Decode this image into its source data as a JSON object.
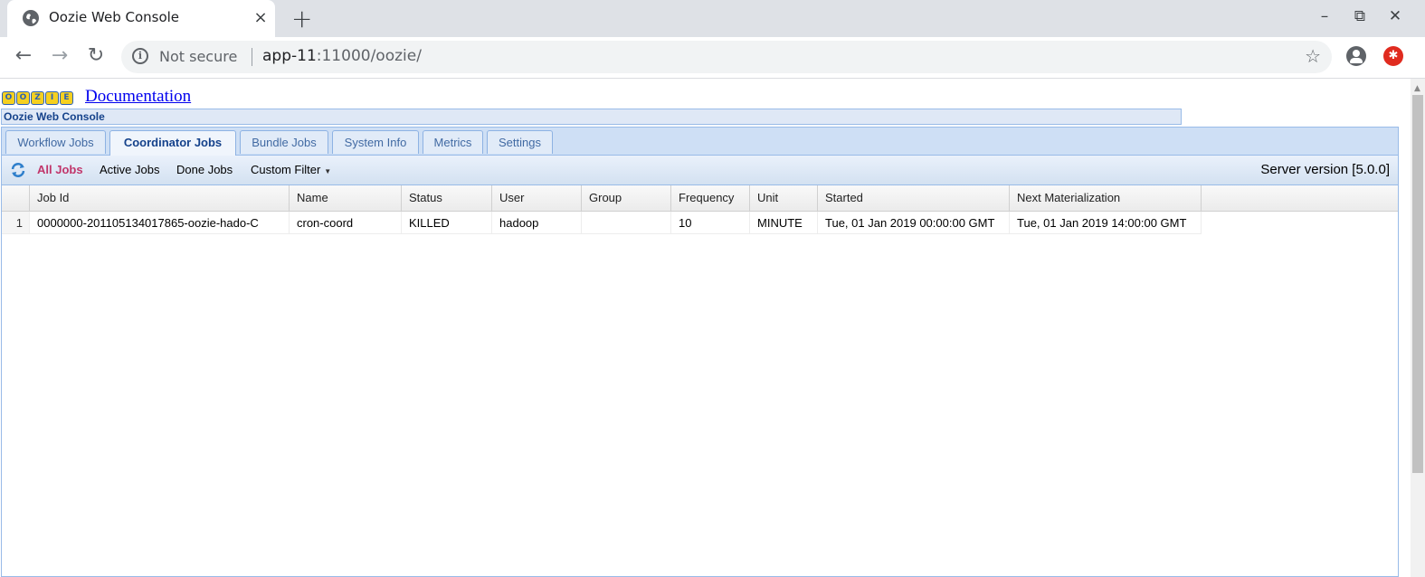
{
  "browser": {
    "tab_title": "Oozie Web Console",
    "tab_close": "×",
    "new_tab": "+",
    "window_controls": {
      "minimize": "–",
      "restore": "⧉",
      "close": "✕"
    },
    "nav": {
      "back": "←",
      "forward": "→",
      "reload": "↻"
    },
    "security_label": "Not secure",
    "url_host": "app-11",
    "url_rest": ":11000/oozie/",
    "star": "☆",
    "extension_badge": "✱"
  },
  "page": {
    "logo_letters": [
      "O",
      "O",
      "Z",
      "I",
      "E"
    ],
    "documentation_link": "Documentation",
    "console_title": "Oozie Web Console",
    "tabs": [
      {
        "label": "Workflow Jobs",
        "active": false
      },
      {
        "label": "Coordinator Jobs",
        "active": true
      },
      {
        "label": "Bundle Jobs",
        "active": false
      },
      {
        "label": "System Info",
        "active": false
      },
      {
        "label": "Metrics",
        "active": false
      },
      {
        "label": "Settings",
        "active": false
      }
    ],
    "filters": {
      "all_jobs": "All Jobs",
      "active_jobs": "Active Jobs",
      "done_jobs": "Done Jobs",
      "custom_filter": "Custom Filter",
      "custom_filter_caret": "▼"
    },
    "server_version": "Server version [5.0.0]",
    "accent_color": "#c1356a",
    "table": {
      "columns": [
        "Job Id",
        "Name",
        "Status",
        "User",
        "Group",
        "Frequency",
        "Unit",
        "Started",
        "Next Materialization"
      ],
      "rows": [
        {
          "num": "1",
          "job_id": "0000000-201105134017865-oozie-hado-C",
          "name": "cron-coord",
          "status": "KILLED",
          "user": "hadoop",
          "group": "",
          "frequency": "10",
          "unit": "MINUTE",
          "started": "Tue, 01 Jan 2019 00:00:00 GMT",
          "next_materialization": "Tue, 01 Jan 2019 14:00:00 GMT"
        }
      ]
    }
  }
}
